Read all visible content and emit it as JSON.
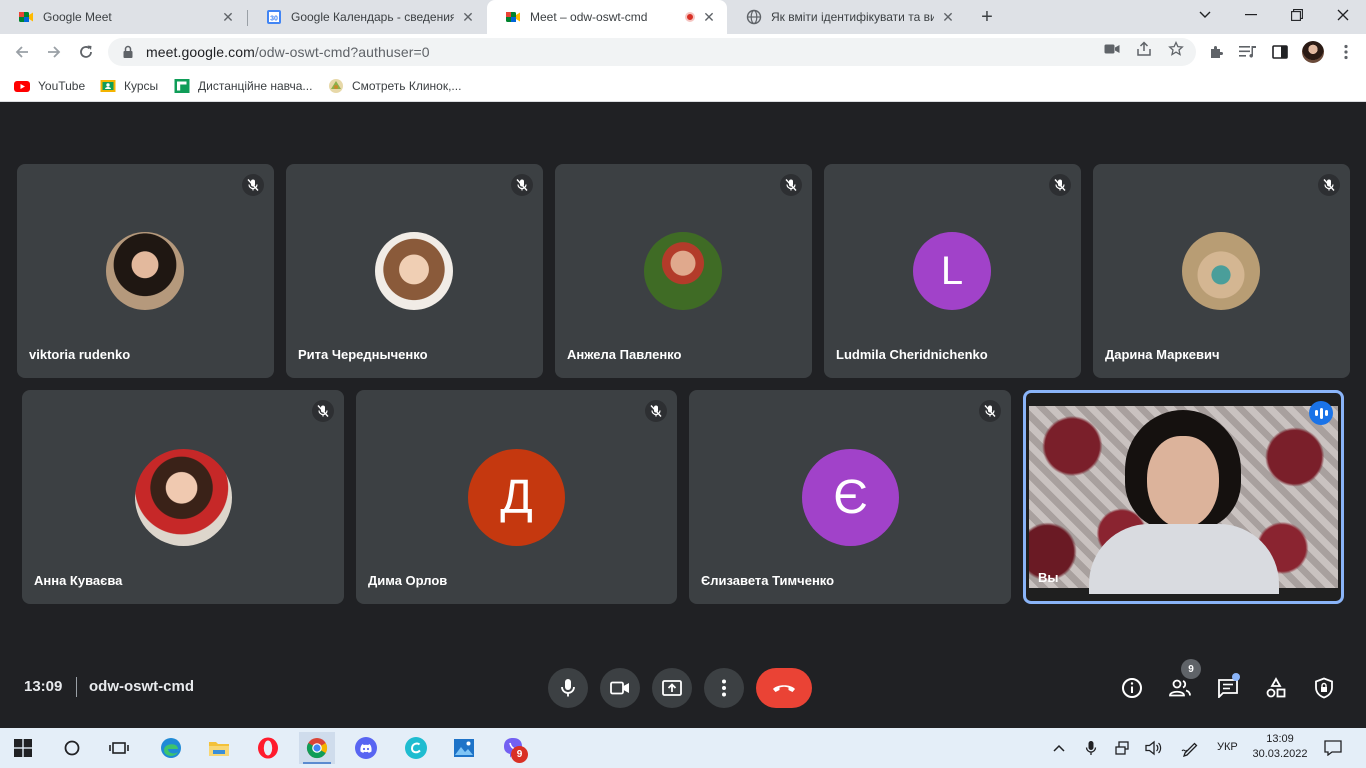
{
  "browser": {
    "tabs": [
      {
        "title": "Google Meet",
        "active": false
      },
      {
        "title": "Google Календарь - сведения о",
        "active": false
      },
      {
        "title": "Meet – odw-oswt-cmd",
        "active": true
      },
      {
        "title": "Як вміти ідентифікувати та вирі",
        "active": false
      }
    ],
    "calendar_favicon_text": "30",
    "url": {
      "host": "meet.google.com",
      "path": "/odw-oswt-cmd?authuser=0"
    },
    "bookmarks": [
      {
        "label": "YouTube",
        "icon": "youtube-icon"
      },
      {
        "label": "Курсы",
        "icon": "classroom-icon"
      },
      {
        "label": "Дистанційне навча...",
        "icon": "classroom-green-icon"
      },
      {
        "label": "Смотреть Клинок,...",
        "icon": "site-icon"
      }
    ]
  },
  "meet": {
    "participants_row1": [
      {
        "name": "viktoria rudenko",
        "avatar": "photo",
        "colors": [
          "#6b4f3a",
          "#1c1c1c"
        ]
      },
      {
        "name": "Рита Чередныченко",
        "avatar": "photo",
        "colors": [
          "#d9c2a9",
          "#8a5a3a"
        ]
      },
      {
        "name": "Анжела Павленко",
        "avatar": "photo",
        "colors": [
          "#4d7a2e",
          "#c0392b"
        ]
      },
      {
        "name": "Ludmila Cheridnichenko",
        "avatar": "letter",
        "letter": "L",
        "color": "#a142c9"
      },
      {
        "name": "Дарина Маркевич",
        "avatar": "photo",
        "colors": [
          "#c9b28a",
          "#4a7f80"
        ]
      }
    ],
    "participants_row2": [
      {
        "name": "Анна Куваєва",
        "avatar": "photo",
        "colors": [
          "#d9d2c7",
          "#c62828"
        ]
      },
      {
        "name": "Дима Орлов",
        "avatar": "letter",
        "letter": "Д",
        "color": "#c5380f"
      },
      {
        "name": "Єлизавета Тимченко",
        "avatar": "letter",
        "letter": "Є",
        "color": "#a142c9"
      }
    ],
    "self": {
      "name": "Вы"
    },
    "time": "13:09",
    "meeting_code": "odw-oswt-cmd",
    "people_count": "9"
  },
  "taskbar": {
    "viber_badge": "9",
    "language": "УКР",
    "time": "13:09",
    "date": "30.03.2022"
  },
  "colors": {
    "meet_bg": "#202124",
    "tile_bg": "#3c4043",
    "end_call": "#ea4335",
    "accent_blue": "#1a73e8",
    "self_border": "#8ab4f8"
  }
}
